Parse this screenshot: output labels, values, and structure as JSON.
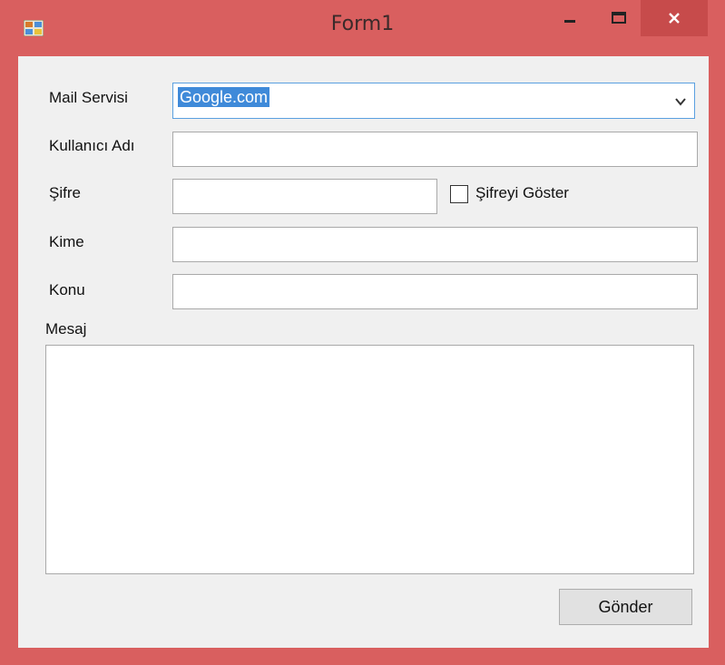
{
  "window": {
    "title": "Form1",
    "minimize": "–",
    "maximize": "□",
    "close": "✕"
  },
  "form": {
    "mail_service_label": "Mail Servisi",
    "mail_service_value": "Google.com",
    "username_label": "Kullanıcı Adı",
    "username_value": "",
    "password_label": "Şifre",
    "password_value": "",
    "show_password_label": "Şifreyi Göster",
    "show_password_checked": false,
    "to_label": "Kime",
    "to_value": "",
    "subject_label": "Konu",
    "subject_value": "",
    "message_label": "Mesaj",
    "message_value": "",
    "send_label": "Gönder"
  },
  "colors": {
    "frame": "#d95f5f",
    "client": "#f0f0f0",
    "selection": "#3f8ad9"
  }
}
